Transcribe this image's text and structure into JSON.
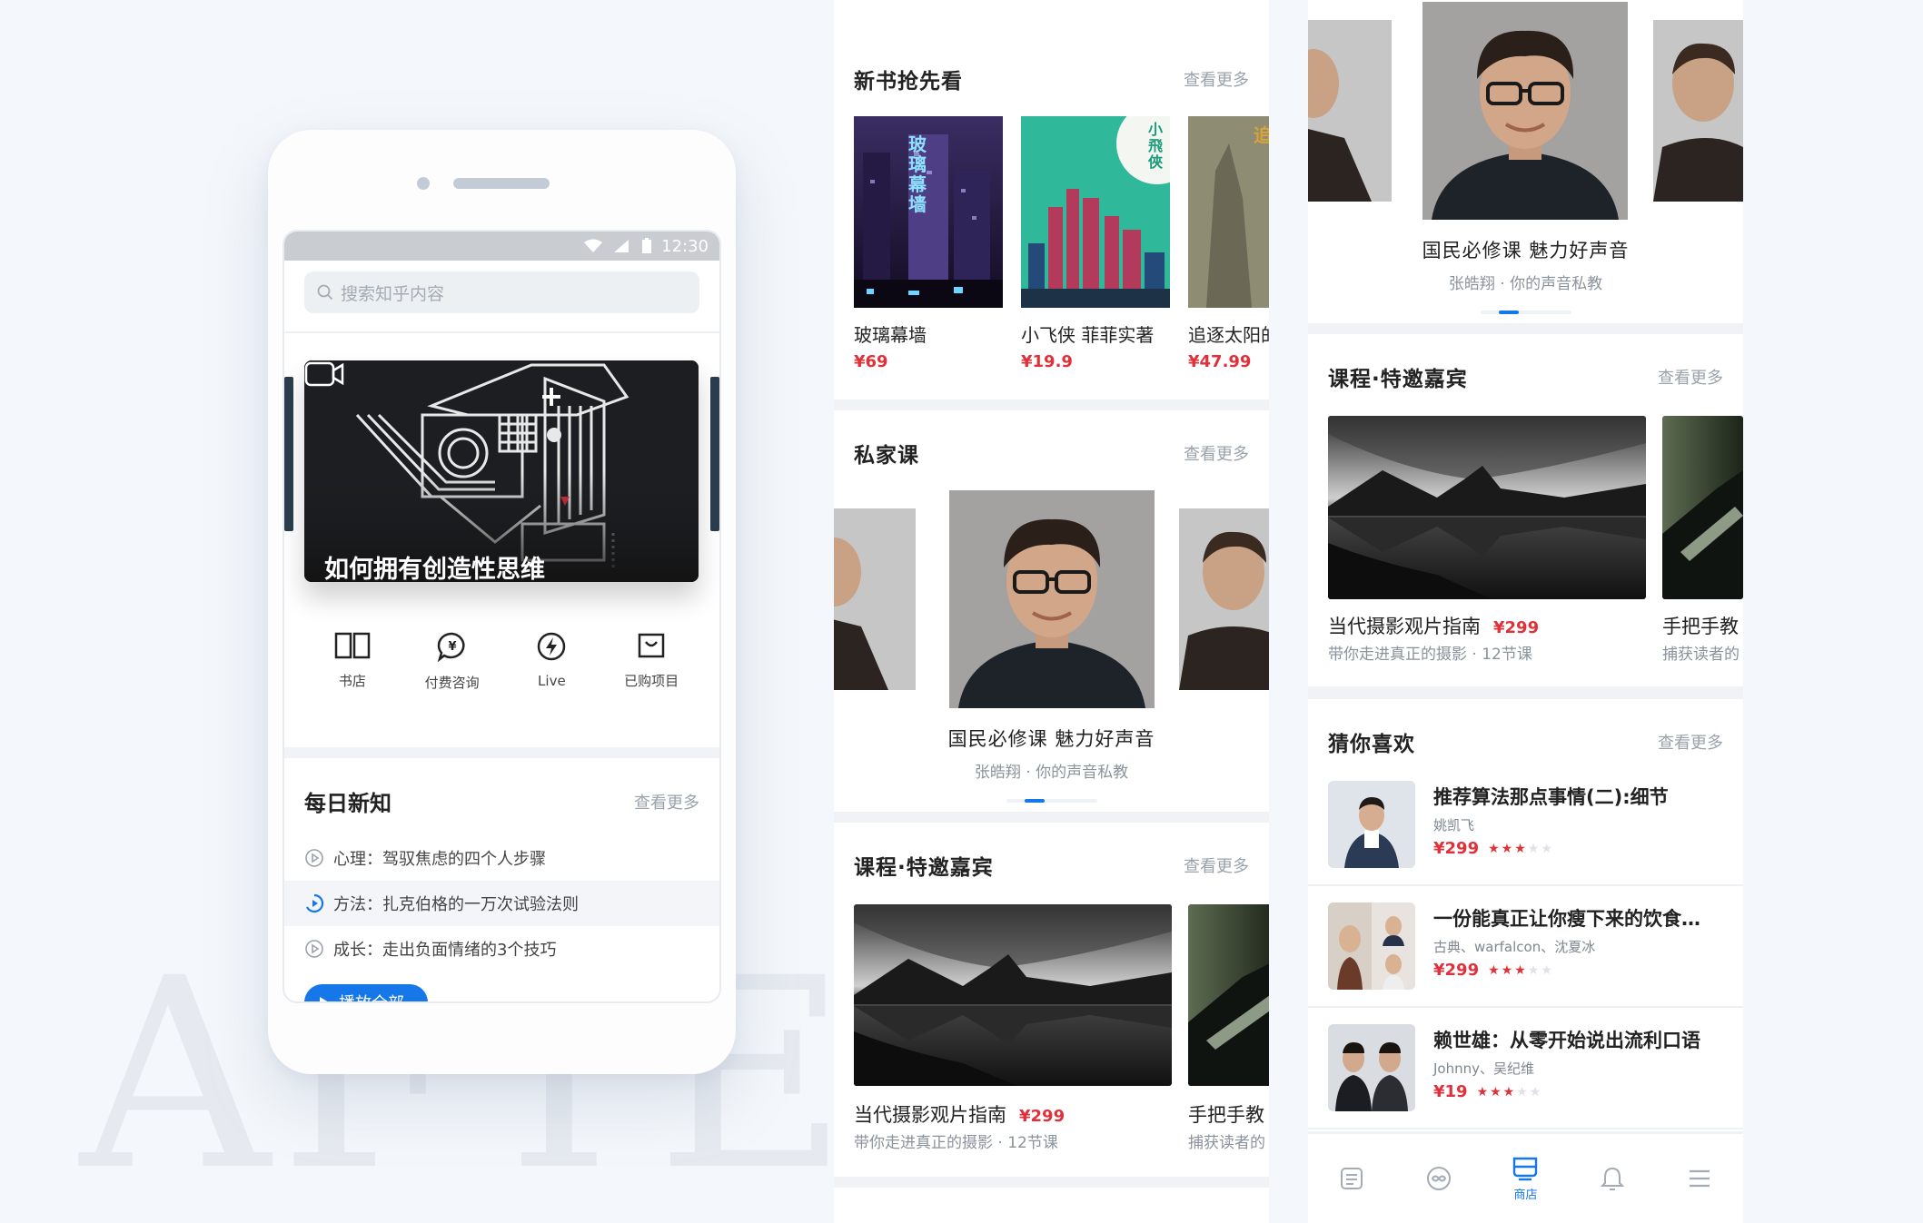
{
  "watermark": "AFTER",
  "status": {
    "time": "12:30"
  },
  "search": {
    "placeholder": "搜索知乎内容"
  },
  "banner": {
    "title": "如何拥有创造性思维",
    "camera_icon": "video-camera-icon"
  },
  "quick_links": [
    {
      "label": "书店",
      "icon": "open-book-icon"
    },
    {
      "label": "付费咨询",
      "icon": "chat-yen-icon"
    },
    {
      "label": "Live",
      "icon": "lightning-icon"
    },
    {
      "label": "已购项目",
      "icon": "shopping-bag-icon"
    }
  ],
  "daily": {
    "title": "每日新知",
    "more": "查看更多",
    "items": [
      {
        "text": "心理：驾驭焦虑的四个人步骤",
        "active": false
      },
      {
        "text": "方法：扎克伯格的一万次试验法则",
        "active": true
      },
      {
        "text": "成长：走出负面情绪的3个技巧",
        "active": false
      }
    ],
    "play_all": "播放全部"
  },
  "new_books": {
    "title": "新书抢先看",
    "more": "查看更多",
    "items": [
      {
        "name": "玻璃幕墙",
        "price": "¥69",
        "cover_text": "玻璃幕墙"
      },
      {
        "name": "小飞侠 菲菲实著",
        "price": "¥19.9",
        "cover_text": "小飛俠"
      },
      {
        "name": "追逐太阳的",
        "price": "¥47.99",
        "cover_text": "追"
      }
    ]
  },
  "private_course": {
    "title": "私家课",
    "more": "查看更多",
    "course_title": "国民必修课 魅力好声音",
    "course_sub": "张皓翔 · 你的声音私教"
  },
  "right_top": {
    "course_title": "国民必修课 魅力好声音",
    "course_sub": "张皓翔 · 你的声音私教"
  },
  "guest_courses": {
    "title": "课程·特邀嘉宾",
    "more": "查看更多",
    "items": [
      {
        "name": "当代摄影观片指南",
        "price": "¥299",
        "sub": "带你走进真正的摄影 · 12节课"
      },
      {
        "name": "手把手教",
        "price": "",
        "sub": "捕获读者的"
      }
    ]
  },
  "guess": {
    "title": "猜你喜欢",
    "more": "查看更多",
    "items": [
      {
        "title": "推荐算法那点事情(二):细节",
        "author": "姚凯飞",
        "price": "¥299",
        "stars": 3
      },
      {
        "title": "一份能真正让你瘦下来的饮食…",
        "author": "古典、warfalcon、沈夏冰",
        "price": "¥299",
        "stars": 3
      },
      {
        "title": "赖世雄：从零开始说出流利口语",
        "author": "Johnny、吴纪维",
        "price": "¥19",
        "stars": 3
      }
    ]
  },
  "tabbar": {
    "items": [
      {
        "icon": "feed-list-icon",
        "label": ""
      },
      {
        "icon": "infinity-icon",
        "label": ""
      },
      {
        "icon": "store-icon",
        "label": "商店",
        "active": true
      },
      {
        "icon": "bell-icon",
        "label": ""
      },
      {
        "icon": "menu-icon",
        "label": ""
      }
    ]
  },
  "colors": {
    "accent": "#1677e8",
    "price": "#e0303a"
  }
}
